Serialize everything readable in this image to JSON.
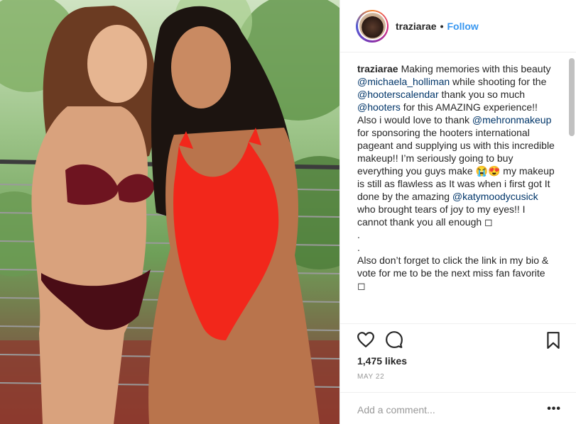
{
  "post": {
    "username": "traziarae",
    "separator": "•",
    "follow_label": "Follow",
    "caption": [
      {
        "type": "user",
        "text": "traziarae"
      },
      {
        "type": "text",
        "text": "Making memories with this beauty "
      },
      {
        "type": "mention",
        "text": "@michaela_holliman"
      },
      {
        "type": "text",
        "text": " while shooting for the "
      },
      {
        "type": "mention",
        "text": "@hooterscalendar"
      },
      {
        "type": "text",
        "text": " thank you so much "
      },
      {
        "type": "mention",
        "text": "@hooters"
      },
      {
        "type": "text",
        "text": " for this AMAZING experience!! Also i would love to thank "
      },
      {
        "type": "mention",
        "text": "@mehronmakeup"
      },
      {
        "type": "text",
        "text": " for sponsoring the hooters international pageant and supplying us with this incredible makeup!! I’m seriously going to buy everything you guys make 😭😍 my makeup is still as flawless as It was when i first got It done by the amazing "
      },
      {
        "type": "mention",
        "text": "@katymoodycusick"
      },
      {
        "type": "text",
        "text": " who brought tears of joy to my eyes!! I cannot thank you all enough ◻"
      },
      {
        "type": "break",
        "text": ""
      },
      {
        "type": "text",
        "text": "."
      },
      {
        "type": "break",
        "text": ""
      },
      {
        "type": "text",
        "text": "."
      },
      {
        "type": "break",
        "text": ""
      },
      {
        "type": "text",
        "text": "Also don’t forget to click the link in my bio & vote for me to be the next miss fan favorite ◻"
      }
    ],
    "likes": "1,475 likes",
    "date": "MAY 22",
    "comment_placeholder": "Add a comment...",
    "more_label": "•••"
  },
  "icons": {
    "like": "heart-icon",
    "comment": "comment-icon",
    "save": "bookmark-icon"
  },
  "colors": {
    "accent": "#3897f0",
    "mention": "#003569",
    "text": "#262626",
    "muted": "#999999"
  }
}
